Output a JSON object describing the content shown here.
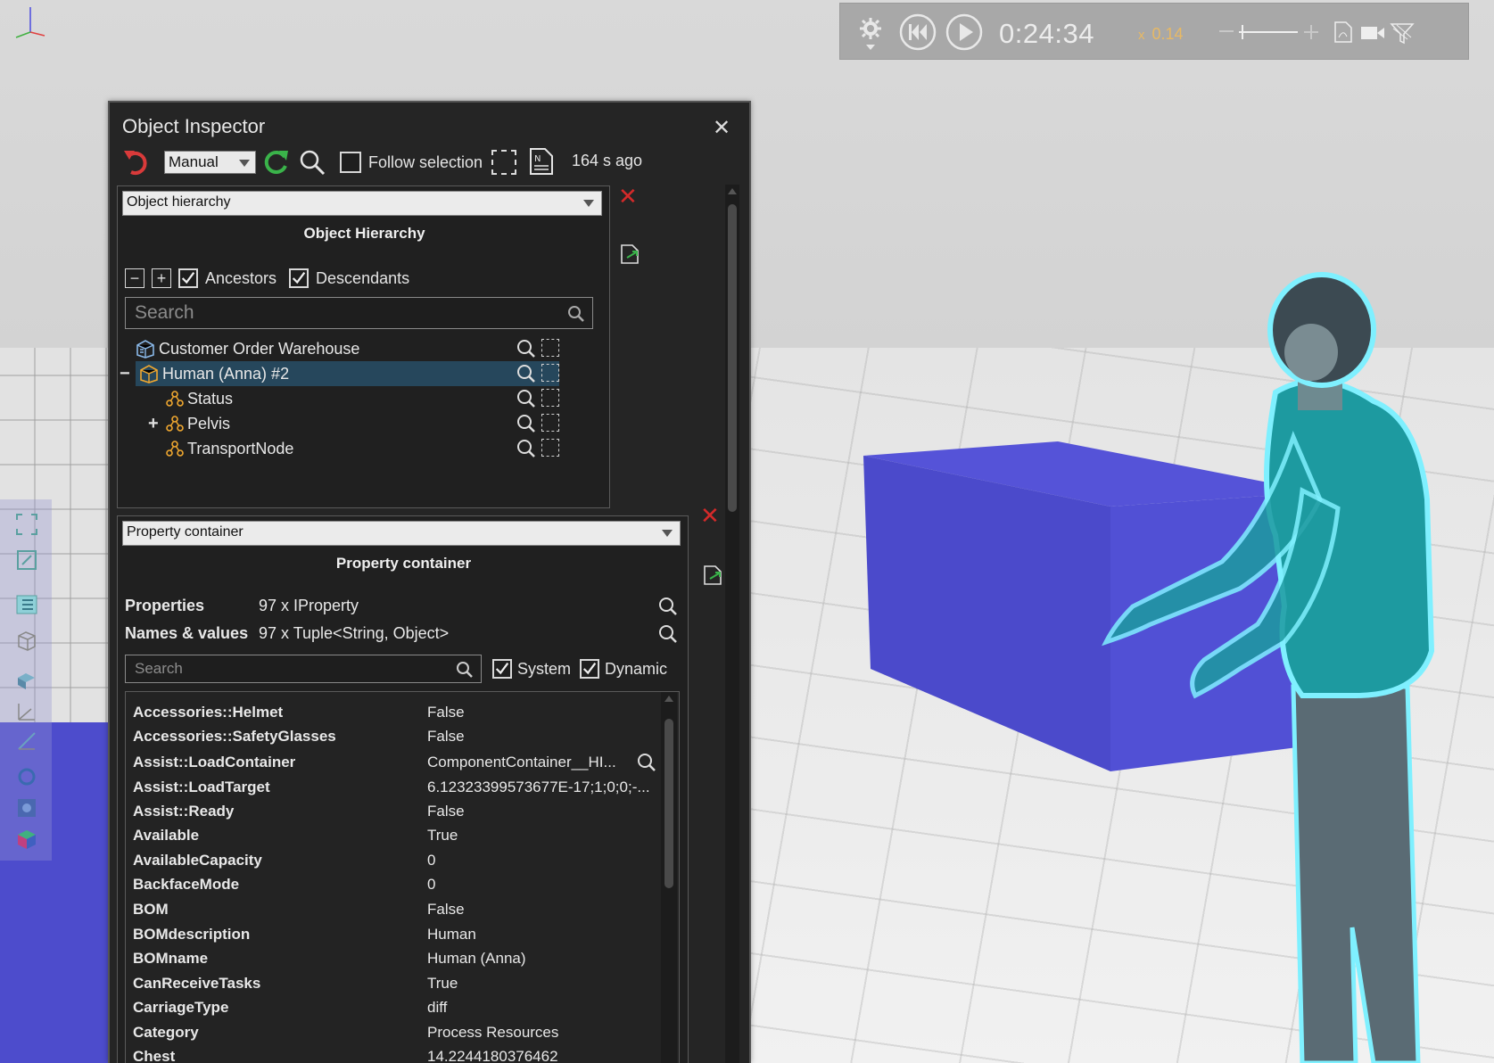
{
  "playback": {
    "time": "0:24:34",
    "speed_prefix": "x",
    "speed": "0.14",
    "icons": [
      "gear-icon",
      "rewind-icon",
      "play-icon",
      "zoom-out-icon",
      "slider",
      "zoom-in-icon",
      "pdf-icon",
      "camera-icon",
      "filter-icon"
    ]
  },
  "inspector": {
    "title": "Object Inspector",
    "close": "✕",
    "toolbar": {
      "mode": "Manual",
      "follow_selection": "Follow selection",
      "follow_checked": false,
      "updated": "164 s ago"
    },
    "hierarchy": {
      "dropdown": "Object hierarchy",
      "title": "Object Hierarchy",
      "collapse": "−",
      "expand": "+",
      "ancestors": "Ancestors",
      "descendants": "Descendants",
      "search_placeholder": "Search",
      "items": [
        {
          "label": "Customer Order Warehouse",
          "icon": "warehouse-icon",
          "expander": "",
          "level": 0
        },
        {
          "label": "Human (Anna) #2",
          "icon": "human-component-icon",
          "expander": "−",
          "level": 0,
          "selected": true
        },
        {
          "label": "Status",
          "icon": "node-icon",
          "expander": "",
          "level": 1
        },
        {
          "label": "Pelvis",
          "icon": "node-icon",
          "expander": "+",
          "level": 1
        },
        {
          "label": "TransportNode",
          "icon": "node-icon",
          "expander": "",
          "level": 1
        }
      ]
    },
    "properties": {
      "dropdown": "Property container",
      "title": "Property container",
      "properties_label": "Properties",
      "properties_value": "97 x IProperty",
      "names_label": "Names & values",
      "names_value": "97 x Tuple<String, Object>",
      "search_placeholder": "Search",
      "system": "System",
      "dynamic": "Dynamic",
      "rows": [
        {
          "name": "Accessories::Helmet",
          "value": "False"
        },
        {
          "name": "Accessories::SafetyGlasses",
          "value": "False"
        },
        {
          "name": "Assist::LoadContainer",
          "value": "ComponentContainer__HI..."
        },
        {
          "name": "Assist::LoadTarget",
          "value": "6.12323399573677E-17;1;0;0;-..."
        },
        {
          "name": "Assist::Ready",
          "value": "False"
        },
        {
          "name": "Available",
          "value": "True"
        },
        {
          "name": "AvailableCapacity",
          "value": "0"
        },
        {
          "name": "BackfaceMode",
          "value": "0"
        },
        {
          "name": "BOM",
          "value": "False"
        },
        {
          "name": "BOMdescription",
          "value": "Human"
        },
        {
          "name": "BOMname",
          "value": "Human (Anna)"
        },
        {
          "name": "CanReceiveTasks",
          "value": "True"
        },
        {
          "name": "CarriageType",
          "value": "diff"
        },
        {
          "name": "Category",
          "value": "Process Resources"
        },
        {
          "name": "Chest",
          "value": "14.2244180376462"
        }
      ]
    }
  }
}
